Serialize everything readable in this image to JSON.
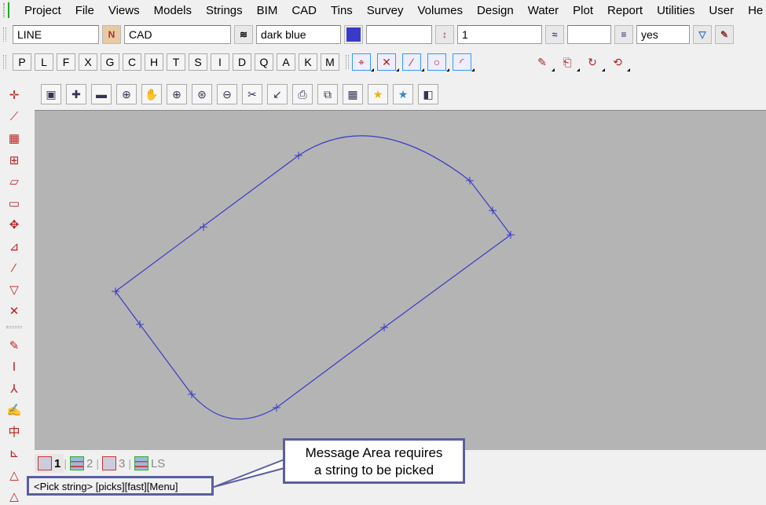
{
  "menu": [
    "Project",
    "File",
    "Views",
    "Models",
    "Strings",
    "BIM",
    "CAD",
    "Tins",
    "Survey",
    "Volumes",
    "Design",
    "Water",
    "Plot",
    "Report",
    "Utilities",
    "User",
    "He"
  ],
  "properties": {
    "string_type": "LINE",
    "model": "CAD",
    "colour": "dark blue",
    "colour_hex": "#3a3ac8",
    "height": "",
    "weight": "1",
    "linestyle": "",
    "breakline": "yes"
  },
  "snap_buttons": [
    "P",
    "L",
    "F",
    "X",
    "G",
    "C",
    "H",
    "T",
    "S",
    "I",
    "D",
    "Q",
    "A",
    "K",
    "M"
  ],
  "view_tabs": [
    {
      "label": "1",
      "active": true
    },
    {
      "label": "2",
      "active": false
    },
    {
      "label": "3",
      "active": false
    },
    {
      "label": "LS",
      "active": false
    }
  ],
  "message": "<Pick string> [picks][fast][Menu]",
  "callout": {
    "line1": "Message Area requires",
    "line2": "a string to be picked"
  },
  "colors": {
    "canvas": "#b4b4b4",
    "string": "#3a3ac8",
    "callout_border": "#5a5ea0"
  }
}
